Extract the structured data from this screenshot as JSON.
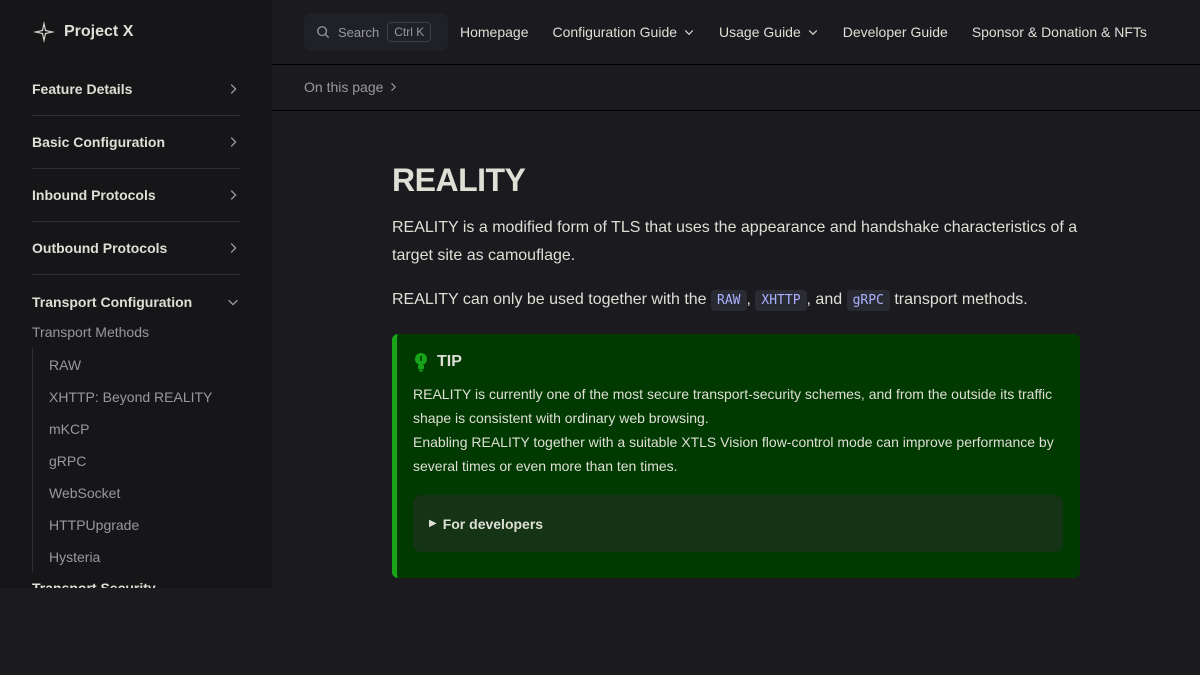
{
  "brand": {
    "name": "Project X"
  },
  "sidebar": {
    "groups": [
      {
        "label": "Feature Details"
      },
      {
        "label": "Basic Configuration"
      },
      {
        "label": "Inbound Protocols"
      },
      {
        "label": "Outbound Protocols"
      },
      {
        "label": "Transport Configuration"
      }
    ],
    "subheading": "Transport Methods",
    "items": [
      "RAW",
      "XHTTP: Beyond REALITY",
      "mKCP",
      "gRPC",
      "WebSocket",
      "HTTPUpgrade",
      "Hysteria"
    ],
    "cut_item": "Transport Security"
  },
  "search": {
    "placeholder": "Search",
    "kbd_ctrl": "Ctrl",
    "kbd_key": "K"
  },
  "nav": {
    "homepage": "Homepage",
    "config_guide": "Configuration Guide",
    "usage_guide": "Usage Guide",
    "developer_guide": "Developer Guide",
    "sponsor": "Sponsor & Donation & NFTs"
  },
  "local_nav": {
    "on_this_page": "On this page"
  },
  "content": {
    "title": "REALITY",
    "intro": "REALITY is a modified form of TLS that uses the appearance and handshake characteristics of a target site as camouflage.",
    "transport_pre": "REALITY can only be used together with the ",
    "code_raw": "RAW",
    "sep1": ", ",
    "code_xhttp": "XHTTP",
    "sep2": ", and ",
    "code_grpc": "gRPC",
    "transport_post": " transport methods."
  },
  "tip": {
    "title": "TIP",
    "line1": "REALITY is currently one of the most secure transport-security schemes, and from the outside its traffic shape is consistent with ordinary web browsing.",
    "line2": "Enabling REALITY together with a suitable XTLS Vision flow-control mode can improve performance by several times or even more than ten times.",
    "details_label": "For developers"
  },
  "colors": {
    "accent_green": "#18a418",
    "tip_bg": "#003a00",
    "code_text": "#a8b1ff"
  }
}
